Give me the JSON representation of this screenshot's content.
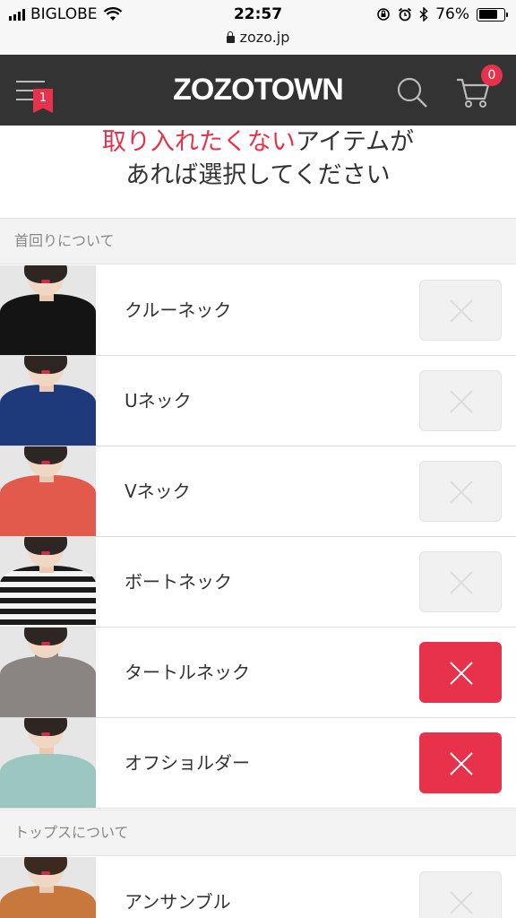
{
  "status_bar": {
    "carrier": "BIGLOBE",
    "time": "22:57",
    "battery": "76%",
    "battery_level": 0.76,
    "icons": [
      "signal-icon",
      "wifi-icon",
      "orientation-lock-icon",
      "alarm-icon",
      "bluetooth-icon",
      "battery-icon"
    ]
  },
  "url_bar": {
    "url": "zozo.jp"
  },
  "header": {
    "logo": "ZOZOTOWN",
    "menu_badge": "1",
    "cart_count": "0",
    "icons": [
      "menu-icon",
      "search-icon",
      "cart-icon"
    ]
  },
  "heading": {
    "highlight": "取り入れたくない",
    "rest_line1": "アイテムが",
    "line2": "あれば選択してください"
  },
  "sections": [
    {
      "title": "首回りについて",
      "items": [
        {
          "label": "クルーネック",
          "selected": false,
          "garment_color": "#141414"
        },
        {
          "label": "Uネック",
          "selected": false,
          "garment_color": "#1f3a7a"
        },
        {
          "label": "Vネック",
          "selected": false,
          "garment_color": "#e25a4c"
        },
        {
          "label": "ボートネック",
          "selected": false,
          "garment_color": "striped"
        },
        {
          "label": "タートルネック",
          "selected": true,
          "garment_color": "#8a8482"
        },
        {
          "label": "オフショルダー",
          "selected": true,
          "garment_color": "#9cc7c0"
        }
      ]
    },
    {
      "title": "トップスについて",
      "items": [
        {
          "label": "アンサンブル",
          "selected": false,
          "garment_color": "#c8783c"
        }
      ]
    }
  ],
  "colors": {
    "accent": "#e8324b",
    "header_bg": "#333333",
    "toggle_off_bg": "#f1f1f1"
  }
}
